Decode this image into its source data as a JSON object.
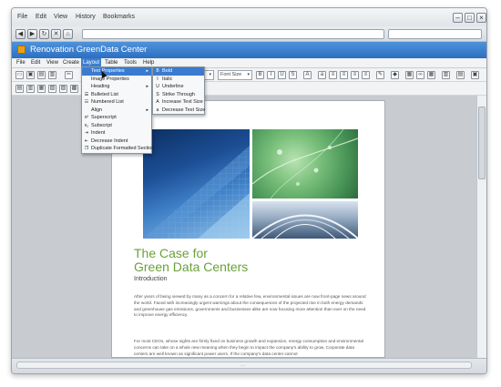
{
  "browser": {
    "menu": [
      "File",
      "Edit",
      "View",
      "History",
      "Bookmarks"
    ],
    "window_controls": [
      "minimize-icon",
      "maximize-icon",
      "close-icon"
    ],
    "nav_buttons": [
      "back-arrow-icon",
      "forward-arrow-icon",
      "reload-icon",
      "stop-icon",
      "home-icon"
    ],
    "url": "",
    "search": ""
  },
  "app": {
    "title": "Renovation GreenData Center",
    "menu": [
      "File",
      "Edit",
      "View",
      "Create",
      "Layout",
      "Table",
      "Tools",
      "Help"
    ],
    "active_menu": "Layout"
  },
  "toolbar": {
    "font_size_placeholder": "Font Size"
  },
  "layout_menu": {
    "items": [
      {
        "label": "Text Properties",
        "icon": "",
        "submenu": true,
        "highlighted": true
      },
      {
        "label": "Image Properties",
        "icon": ""
      },
      {
        "label": "Heading",
        "icon": "",
        "submenu": true
      },
      {
        "label": "Bulleted List",
        "icon": "bulleted-list-icon"
      },
      {
        "label": "Numbered List",
        "icon": "numbered-list-icon"
      },
      {
        "label": "Align",
        "icon": "",
        "submenu": true
      },
      {
        "label": "Superscript",
        "icon": "superscript-icon"
      },
      {
        "label": "Subscript",
        "icon": "subscript-icon"
      },
      {
        "label": "Indent",
        "icon": "indent-icon"
      },
      {
        "label": "Decrease Indent",
        "icon": "decrease-indent-icon"
      },
      {
        "label": "Duplicate Formatted Section",
        "icon": "duplicate-icon"
      }
    ]
  },
  "text_properties_menu": {
    "items": [
      {
        "label": "Bold",
        "icon": "bold-icon",
        "highlighted": true
      },
      {
        "label": "Italic",
        "icon": "italic-icon"
      },
      {
        "label": "Underline",
        "icon": "underline-icon"
      },
      {
        "label": "Strike Through",
        "icon": "strike-through-icon"
      },
      {
        "label": "Increase Text Size",
        "icon": "increase-text-size-icon"
      },
      {
        "label": "Decrease Text Size",
        "icon": "decrease-text-size-icon"
      }
    ]
  },
  "document": {
    "title_line1": "The Case for",
    "title_line2": "Green Data Centers",
    "section_heading": "Introduction",
    "para1": "After years of being viewed by many as a concern for a relative few, environmental issues are now front-page news around the world. Faced with increasingly urgent warnings about the consequences of the projected rise in both energy demands and greenhouse gas emissions, governments and businesses alike are now focusing more attention than ever on the need to improve energy efficiency.",
    "para2": "For most CEOs, whose sights are firmly fixed on business growth and expansion, energy consumption and environmental concerns can take on a whole new meaning when they begin to impact the company's ability to grow. Corporate data centers are well known as significant power users. If the company's data center cannot"
  },
  "colors": {
    "title_bar": "#2d6fc0",
    "menu_highlight": "#3a7bd0",
    "doc_title": "#6aa13a"
  }
}
